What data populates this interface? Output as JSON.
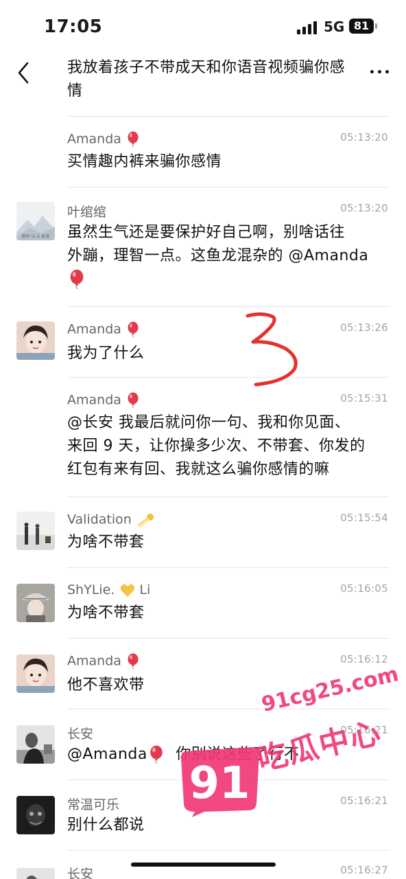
{
  "status_bar": {
    "time": "17:05",
    "network": "5G",
    "battery": "81"
  },
  "header": {
    "title_line1": "我放着孩子不带成天和你语音视频骗你感",
    "title_line2": "情"
  },
  "messages": [
    {
      "name": "Amanda",
      "name_suffix": "balloon",
      "time": "05:13:20",
      "text": "买情趣内裤来骗你感情"
    },
    {
      "name": "叶绾绾",
      "time": "05:13:20",
      "text_line1": "虽然生气还是要保护好自己啊，别啥话往",
      "text_line2": "外蹦，理智一点。这鱼龙混杂的 @Amanda",
      "text_line3_icon": "balloon",
      "avatar_text": "那时 山 & 此夜"
    },
    {
      "name": "Amanda",
      "name_suffix": "balloon",
      "time": "05:13:26",
      "text": "我为了什么"
    },
    {
      "name": "Amanda",
      "name_suffix": "balloon",
      "time": "05:15:31",
      "text_line1": "@长安 我最后就问你一句、我和你见面、",
      "text_line2": "来回 9 天，让你操多少次、不带套、你发的",
      "text_line3": "红包有来有回、我就这么骗你感情的嘛"
    },
    {
      "name": "Validation",
      "name_suffix": "comet",
      "time": "05:15:54",
      "text": "为啥不带套"
    },
    {
      "name": "ShYLie.",
      "name_suffix": "yellow-heart",
      "name_tail": "Li",
      "time": "05:16:05",
      "text": "为啥不带套"
    },
    {
      "name": "Amanda",
      "name_suffix": "balloon",
      "time": "05:16:12",
      "text": "他不喜欢带"
    },
    {
      "name": "长安",
      "time": "05:16:21",
      "text_prefix": "@Amanda",
      "text_suffix": "你别说这些了行不"
    },
    {
      "name": "常温可乐",
      "time": "05:16:21",
      "text": "别什么都说"
    },
    {
      "name": "长安",
      "time": "05:16:27"
    }
  ],
  "overlay": {
    "handwritten_mark": "3"
  },
  "watermark": {
    "badge_number": "91",
    "domain": "91cg25.com",
    "text": "吃瓜中心"
  },
  "colors": {
    "watermark_pink": "#f03778",
    "balloon_red": "#e23a4a",
    "divider": "#e6e6e6"
  }
}
